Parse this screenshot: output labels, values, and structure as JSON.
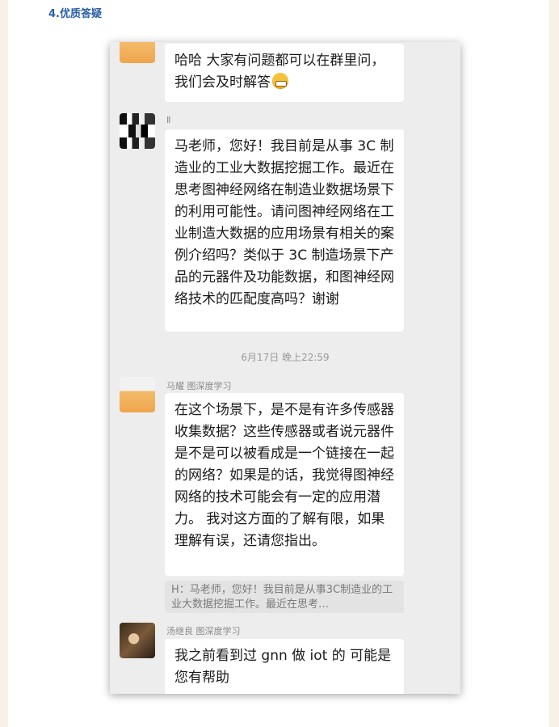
{
  "page": {
    "section_title": "4.优质答疑"
  },
  "chat": {
    "messages": [
      {
        "text": "哈哈 大家有问题都可以在群里问，我们会及时解答",
        "emoji": "grinning-face-emoji"
      },
      {
        "sender": "Ⅱ",
        "text": "马老师，您好！我目前是从事 3C 制造业的工业大数据挖掘工作。最近在思考图神经网络在制造业数据场景下的利用可能性。请问图神经网络在工业制造大数据的应用场景有相关的案例介绍吗？类似于 3C 制造场景下产品的元器件及功能数据，和图神经网络技术的匹配度高吗？谢谢"
      },
      {
        "timestamp": "6月17日 晚上22:59"
      },
      {
        "sender": "马耀 图深度学习",
        "text": "在这个场景下，是不是有许多传感器收集数据？这些传感器或者说元器件是不是可以被看成是一个链接在一起的网络？如果是的话，我觉得图神经网络的技术可能会有一定的应用潜力。 我对这方面的了解有限，如果理解有误，还请您指出。",
        "quote": "H：马老师，您好！我目前是从事3C制造业的工业大数据挖掘工作。最近在思考…"
      },
      {
        "sender": "汤继良 图深度学习",
        "text": "我之前看到过 gnn 做 iot 的 可能是您有帮助"
      }
    ]
  }
}
